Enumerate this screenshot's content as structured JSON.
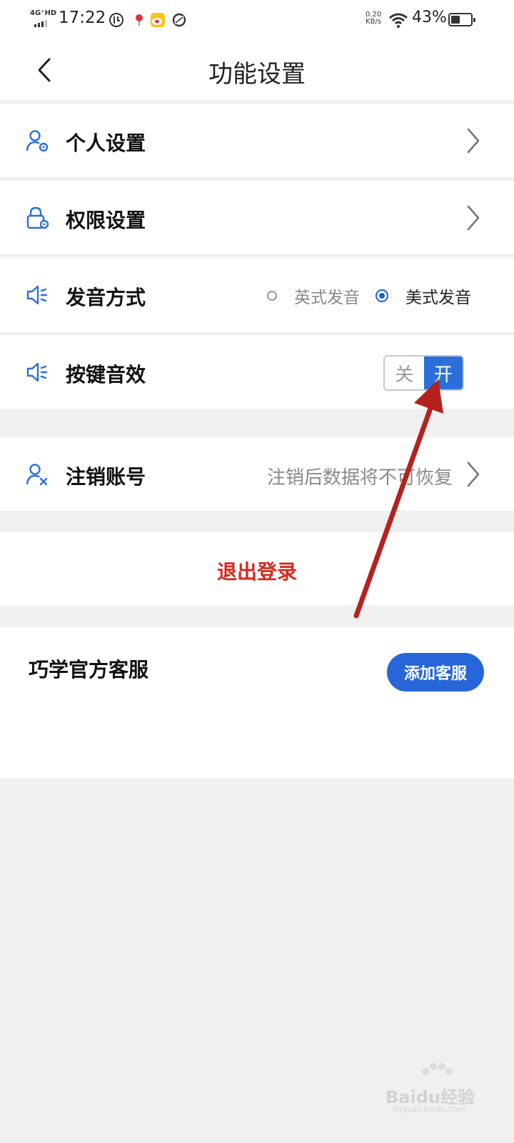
{
  "status_bar": {
    "network": "4G⁺HD",
    "time": "17:22",
    "speed_value": "0.20",
    "speed_unit": "KB/s",
    "battery": "43%"
  },
  "header": {
    "title": "功能设置"
  },
  "rows": {
    "personal": {
      "label": "个人设置"
    },
    "permission": {
      "label": "权限设置"
    },
    "pronunciation": {
      "label": "发音方式",
      "options": [
        "英式发音",
        "美式发音"
      ],
      "selected": "美式发音"
    },
    "key_sound": {
      "label": "按键音效",
      "off_label": "关",
      "on_label": "开",
      "state": "on"
    },
    "cancel_account": {
      "label": "注销账号",
      "hint": "注销后数据将不可恢复"
    },
    "logout": {
      "label": "退出登录"
    },
    "customer_service": {
      "label": "巧学官方客服",
      "button": "添加客服"
    }
  },
  "watermark": {
    "text": "Baidu经验",
    "sub": "jingyan.baidu.com"
  },
  "colors": {
    "accent": "#2666d9",
    "danger": "#d42a1f",
    "annotation_arrow": "#b5211d"
  }
}
